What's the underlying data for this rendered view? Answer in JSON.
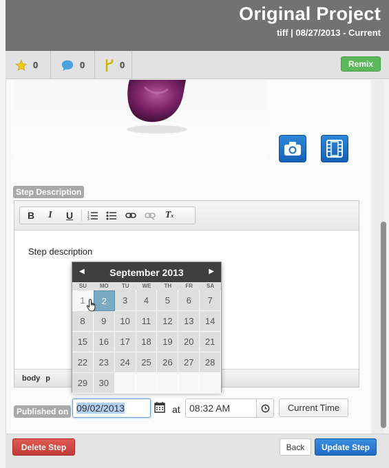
{
  "header": {
    "title": "Original Project",
    "subtitle": "tiff | 08/27/2013 - Current"
  },
  "stats": {
    "favorites": "0",
    "comments": "0",
    "remixes": "0"
  },
  "remix_button": "Remix",
  "step_description_label": "Step Description",
  "editor": {
    "content": "Step description",
    "status_path": [
      "body",
      "p"
    ]
  },
  "published_label": "Published on",
  "date_value": "09/02/2013",
  "at_label": "at",
  "time_value": "08:32 AM",
  "current_time_button": "Current Time",
  "datepicker": {
    "month_label": "September 2013",
    "prev": "◀",
    "next": "▶",
    "weekdays": [
      "SU",
      "MO",
      "TU",
      "WE",
      "TH",
      "FR",
      "SA"
    ],
    "weeks": [
      [
        "1",
        "2",
        "3",
        "4",
        "5",
        "6",
        "7"
      ],
      [
        "8",
        "9",
        "10",
        "11",
        "12",
        "13",
        "14"
      ],
      [
        "15",
        "16",
        "17",
        "18",
        "19",
        "20",
        "21"
      ],
      [
        "22",
        "23",
        "24",
        "25",
        "26",
        "27",
        "28"
      ],
      [
        "29",
        "30",
        "",
        "",
        "",
        "",
        ""
      ]
    ],
    "selected_day": "2",
    "today_day": "1"
  },
  "footer": {
    "delete": "Delete Step",
    "back": "Back",
    "update": "Update Step"
  },
  "colors": {
    "accent_blue": "#1f6cc4",
    "remix_green": "#5cb85c",
    "delete_red": "#c23a35",
    "header_gray": "#727272"
  },
  "icons": [
    "star-icon",
    "comment-icon",
    "fork-icon",
    "camera-icon",
    "video-icon",
    "calendar-icon",
    "clock-icon"
  ]
}
